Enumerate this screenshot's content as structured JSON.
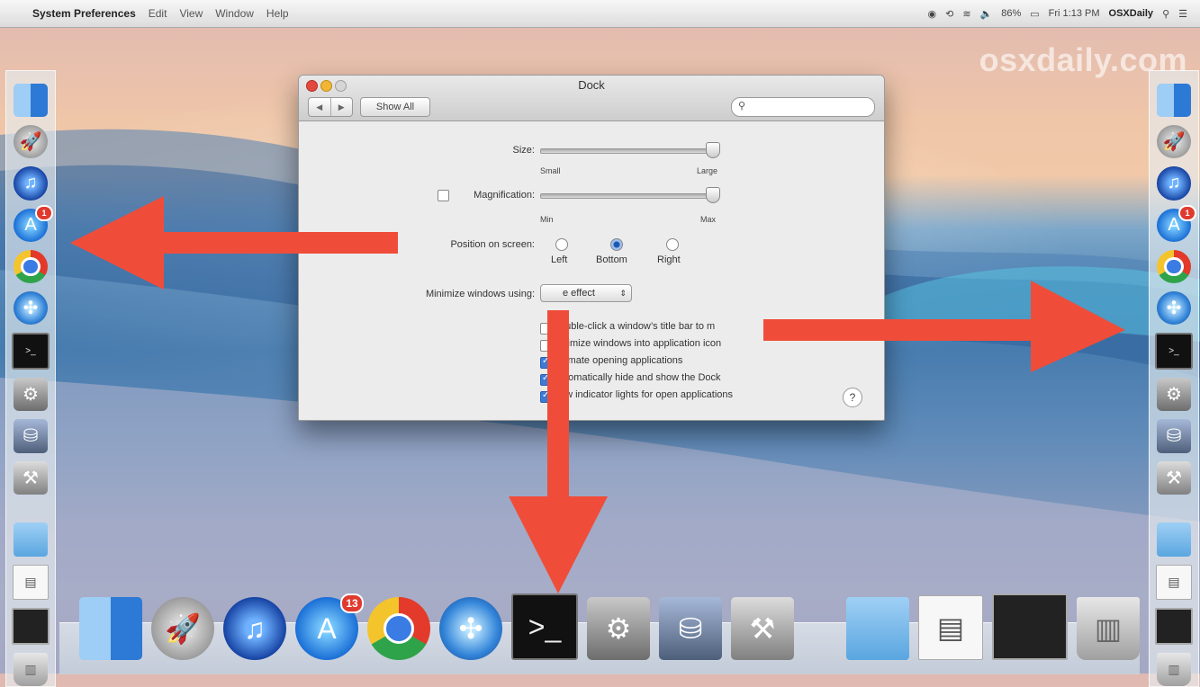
{
  "menubar": {
    "apple_icon": "apple-logo",
    "app_name": "System Preferences",
    "items": [
      "Edit",
      "View",
      "Window",
      "Help"
    ],
    "battery": "86%",
    "clock": "Fri 1:13 PM",
    "user": "OSXDaily"
  },
  "watermark": "osxdaily.com",
  "window": {
    "title": "Dock",
    "show_all": "Show All",
    "search_placeholder": "",
    "size_label": "Size:",
    "size_min": "Small",
    "size_max": "Large",
    "size_value": 1.0,
    "magnification_label": "Magnification:",
    "magnification_checked": false,
    "mag_min": "Min",
    "mag_max": "Max",
    "mag_value": 1.0,
    "position_label": "Position on screen:",
    "position_options": [
      "Left",
      "Bottom",
      "Right"
    ],
    "position_selected": "Bottom",
    "minimize_label": "Minimize windows using:",
    "minimize_value": "e effect",
    "checkboxes": [
      {
        "label": "ouble-click a window’s title bar to m",
        "checked": false
      },
      {
        "label": "inimize windows into application icon",
        "checked": false
      },
      {
        "label": "nimate opening applications",
        "checked": true
      },
      {
        "label": "utomatically hide and show the Dock",
        "checked": true
      },
      {
        "label": "ow indicator lights for open applications",
        "checked": true
      }
    ],
    "help": "?"
  },
  "dock": {
    "app_store_badge": "13",
    "small_badge": "1"
  },
  "colors": {
    "arrow": "#ef4d3a",
    "accent": "#3c7ad6"
  }
}
